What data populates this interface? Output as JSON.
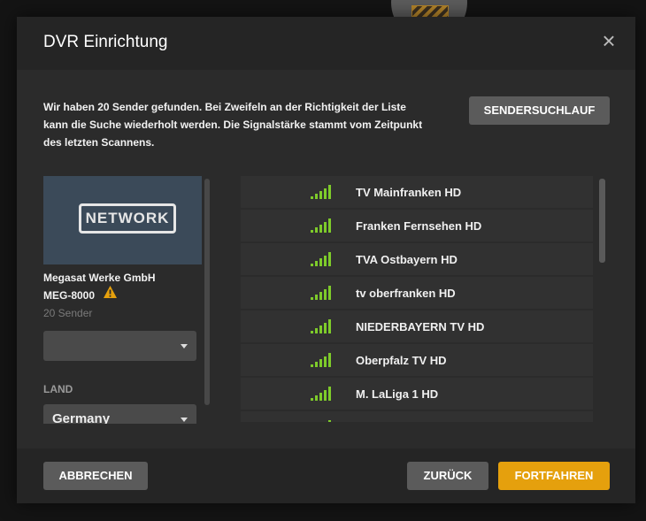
{
  "dialog": {
    "title": "DVR Einrichtung",
    "intro": "Wir haben 20 Sender gefunden. Bei Zweifeln an der Richtigkeit der Liste kann die Suche wiederholt werden. Die Signalstärke stammt vom Zeitpunkt des letzten Scannens.",
    "scan_button": "SENDERSUCHLAUF"
  },
  "device": {
    "badge": "NETWORK",
    "name": "Megasat Werke GmbH",
    "model": "MEG-8000",
    "channel_count": "20 Sender",
    "select_value": "",
    "land_label": "LAND",
    "land_value": "Germany"
  },
  "channels": [
    {
      "name": "TV Mainfranken HD",
      "signal_bars": 5
    },
    {
      "name": "Franken Fernsehen HD",
      "signal_bars": 5
    },
    {
      "name": "TVA Ostbayern HD",
      "signal_bars": 5
    },
    {
      "name": "tv oberfranken HD",
      "signal_bars": 5
    },
    {
      "name": "NIEDERBAYERN TV HD",
      "signal_bars": 5
    },
    {
      "name": "Oberpfalz TV HD",
      "signal_bars": 5
    },
    {
      "name": "M. LaLiga 1 HD",
      "signal_bars": 5
    },
    {
      "name": "",
      "signal_bars": 5
    }
  ],
  "footer": {
    "cancel": "ABBRECHEN",
    "back": "ZURÜCK",
    "continue": "FORTFAHREN"
  },
  "colors": {
    "signal": "#7ecb2a",
    "accent": "#e5a00d",
    "warning": "#e5a00d"
  },
  "icons": {
    "close": "close-icon",
    "warning": "warning-icon",
    "signal": "signal-strength-icon",
    "caret": "chevron-down-icon"
  }
}
